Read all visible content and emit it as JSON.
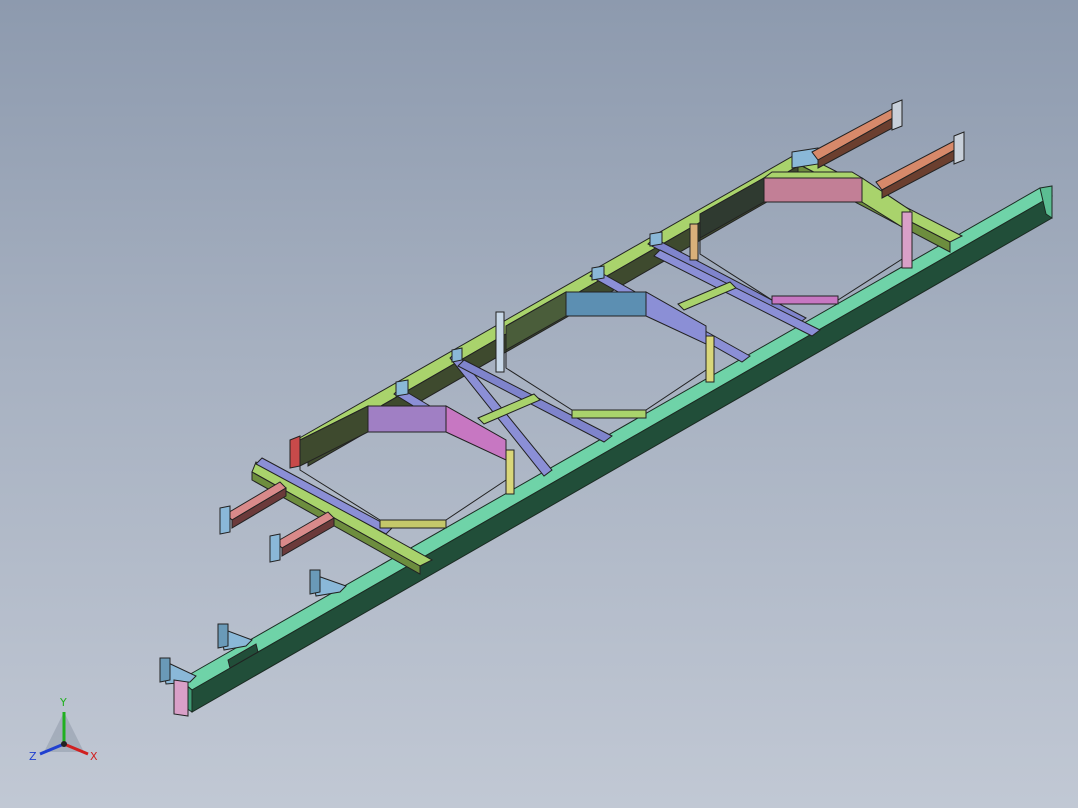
{
  "viewport": {
    "background_top": "#8d9aae",
    "background_bottom": "#c1c8d4"
  },
  "model": {
    "description_icon": "steel-frame-assembly",
    "colors": {
      "main_rail": "#5fc19a",
      "main_rail_dark": "#1f4a35",
      "side_rail": "#a8d06a",
      "side_rail_dark": "#3e4a2e",
      "cross_member": "#8b8fd6",
      "octagon_wall": "#6a8fb0",
      "octagon_wall_pink": "#c77fc0",
      "stub_orange": "#d7896a",
      "stub_blue": "#8ab8d8",
      "stub_pink": "#d98a8a",
      "post_yellow": "#d9d77a",
      "post_pink": "#d9a0c8"
    }
  },
  "triad": {
    "x_label": "X",
    "y_label": "Y",
    "z_label": "Z",
    "x_color": "#d02020",
    "y_color": "#20b020",
    "z_color": "#2040d0"
  }
}
